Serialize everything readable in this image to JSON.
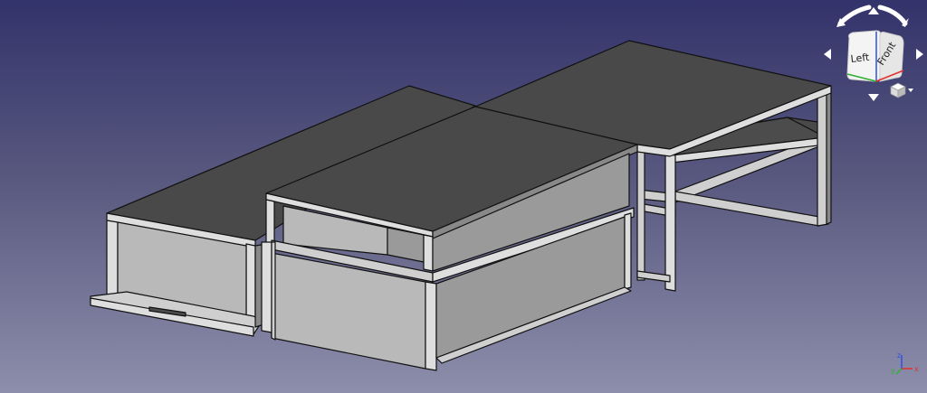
{
  "navigation_cube": {
    "face_left": "Left",
    "face_front": "Front",
    "colors": {
      "x_axis": "#e03030",
      "y_axis": "#30b030",
      "z_axis": "#3050e0",
      "arrows": "#ffffff"
    }
  },
  "axis_indicator": {
    "x": "x",
    "y": "y",
    "z": "z"
  },
  "scene": {
    "background_top": "#33336b",
    "background_bottom": "#8d8eab",
    "model_color": "#bdbdbd"
  }
}
